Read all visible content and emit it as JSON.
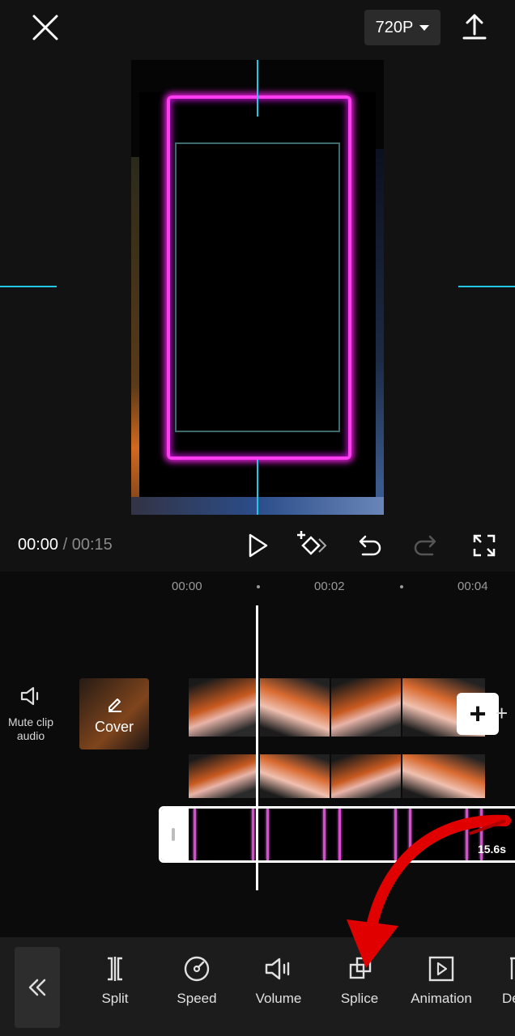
{
  "header": {
    "close_icon": "close-icon",
    "resolution_label": "720P",
    "export_icon": "upload-icon"
  },
  "playback": {
    "current_time": "00:00",
    "separator": " / ",
    "total_time": "00:15"
  },
  "controls": {
    "play_icon": "play-icon",
    "keyframe_icon": "keyframe-icon",
    "undo_icon": "undo-icon",
    "redo_icon": "redo-icon",
    "fullscreen_icon": "fullscreen-icon"
  },
  "ruler": {
    "labels": [
      "00:00",
      "00:02",
      "00:04"
    ]
  },
  "track_controls": {
    "mute_label": "Mute clip audio",
    "cover_label": "Cover"
  },
  "overlay": {
    "duration": "15.6s"
  },
  "toolbar": {
    "items": [
      {
        "label": "Split",
        "icon": "split-icon"
      },
      {
        "label": "Speed",
        "icon": "speed-icon"
      },
      {
        "label": "Volume",
        "icon": "volume-icon"
      },
      {
        "label": "Splice",
        "icon": "splice-icon"
      },
      {
        "label": "Animation",
        "icon": "animation-icon"
      },
      {
        "label": "De",
        "icon": "delete-icon"
      }
    ]
  },
  "colors": {
    "accent_guide": "#22c6e6",
    "neon_frame": "#ff3df0",
    "annotation_arrow": "#e00000"
  }
}
